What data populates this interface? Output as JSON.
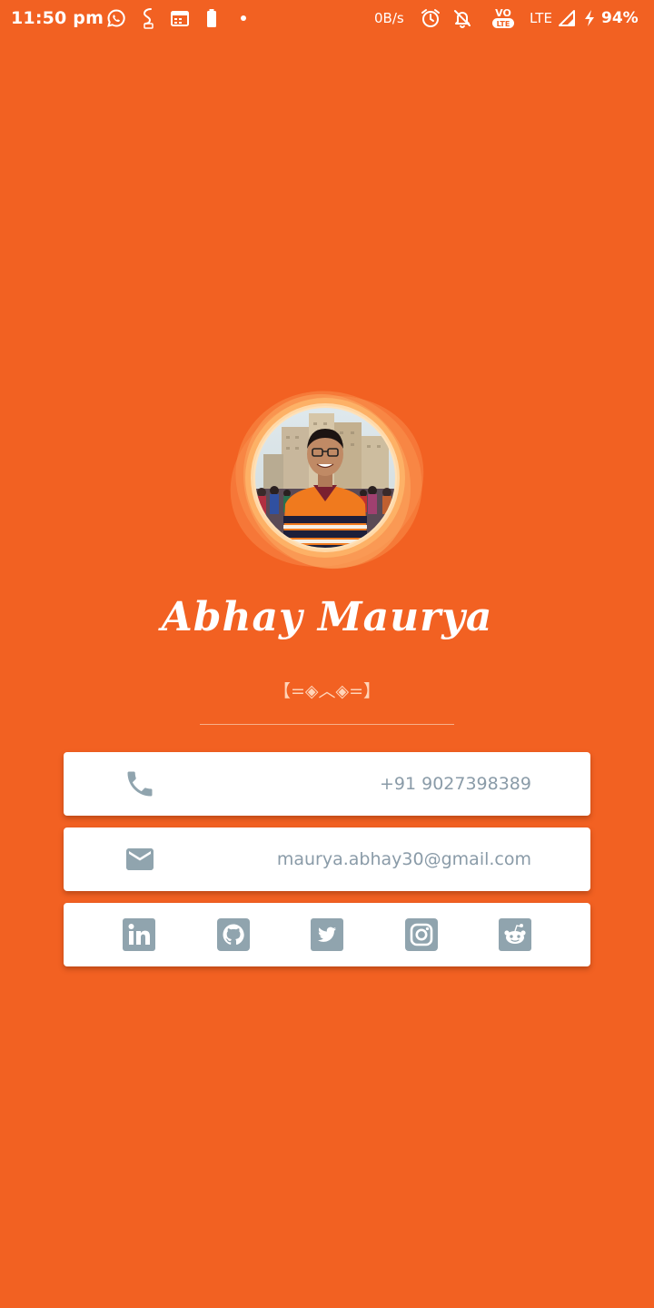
{
  "status_bar": {
    "time": "11:50 pm",
    "net_speed": "0B/s",
    "network_type": "LTE",
    "battery_percent": "94%",
    "icons": [
      "whatsapp-icon",
      "sync-icon",
      "calendar-icon",
      "battery-small-icon",
      "dot-icon",
      "alarm-icon",
      "notifications-off-icon",
      "volte-icon",
      "signal-icon",
      "charging-icon"
    ]
  },
  "profile": {
    "name": "Abhay Maurya",
    "tagline": "【=◈︿◈=】",
    "avatar": "profile-photo"
  },
  "contact": {
    "phone": "+91 9027398389",
    "email": "maurya.abhay30@gmail.com"
  },
  "social": {
    "icons": [
      "linkedin-icon",
      "github-icon",
      "twitter-icon",
      "instagram-icon",
      "reddit-icon"
    ]
  },
  "colors": {
    "background": "#F26122",
    "card": "#FFFFFF",
    "icon_gray": "#90A4AE",
    "text_gray": "#8A9BA8"
  }
}
